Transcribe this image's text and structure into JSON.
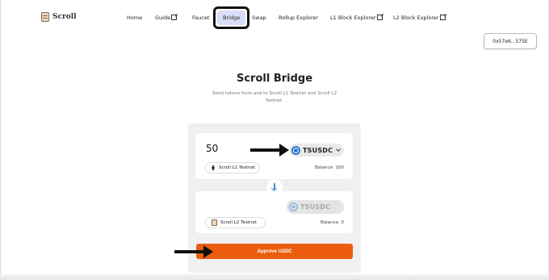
{
  "brand": {
    "name": "Scroll"
  },
  "nav": {
    "items": [
      {
        "label": "Home",
        "external": false
      },
      {
        "label": "Guide",
        "external": true
      },
      {
        "label": "Faucet",
        "external": false
      },
      {
        "label": "Bridge",
        "external": false,
        "active": true
      },
      {
        "label": "Swap",
        "external": false
      },
      {
        "label": "Rollup Explorer",
        "external": false
      },
      {
        "label": "L1 Block Explorer",
        "external": true
      },
      {
        "label": "L2 Block Explorer",
        "external": true
      }
    ]
  },
  "wallet": {
    "address": "0x57e6...575E"
  },
  "page": {
    "title": "Scroll Bridge",
    "subtitle": "Send tokens from and to Scroll L1 Testnet and Scroll L2 Testnet."
  },
  "bridge": {
    "from": {
      "amount": "50",
      "token": "TSUSDC",
      "network": "Scroll L1 Testnet",
      "balance": "Balance: 100"
    },
    "to": {
      "token": "TSUSDC",
      "network": "Scroll L2 Testnet",
      "balance": "Balance: 0"
    },
    "approve_label": "Approve USDC"
  },
  "colors": {
    "accent": "#eb5c0c",
    "active_nav_bg": "#d9ddf7",
    "token_blue": "#2775ca"
  },
  "icons": [
    "scroll-logo-icon",
    "external-link-icon",
    "usdc-token-icon",
    "chevron-down-icon",
    "ethereum-icon",
    "scroll-network-icon",
    "arrow-down-icon"
  ]
}
